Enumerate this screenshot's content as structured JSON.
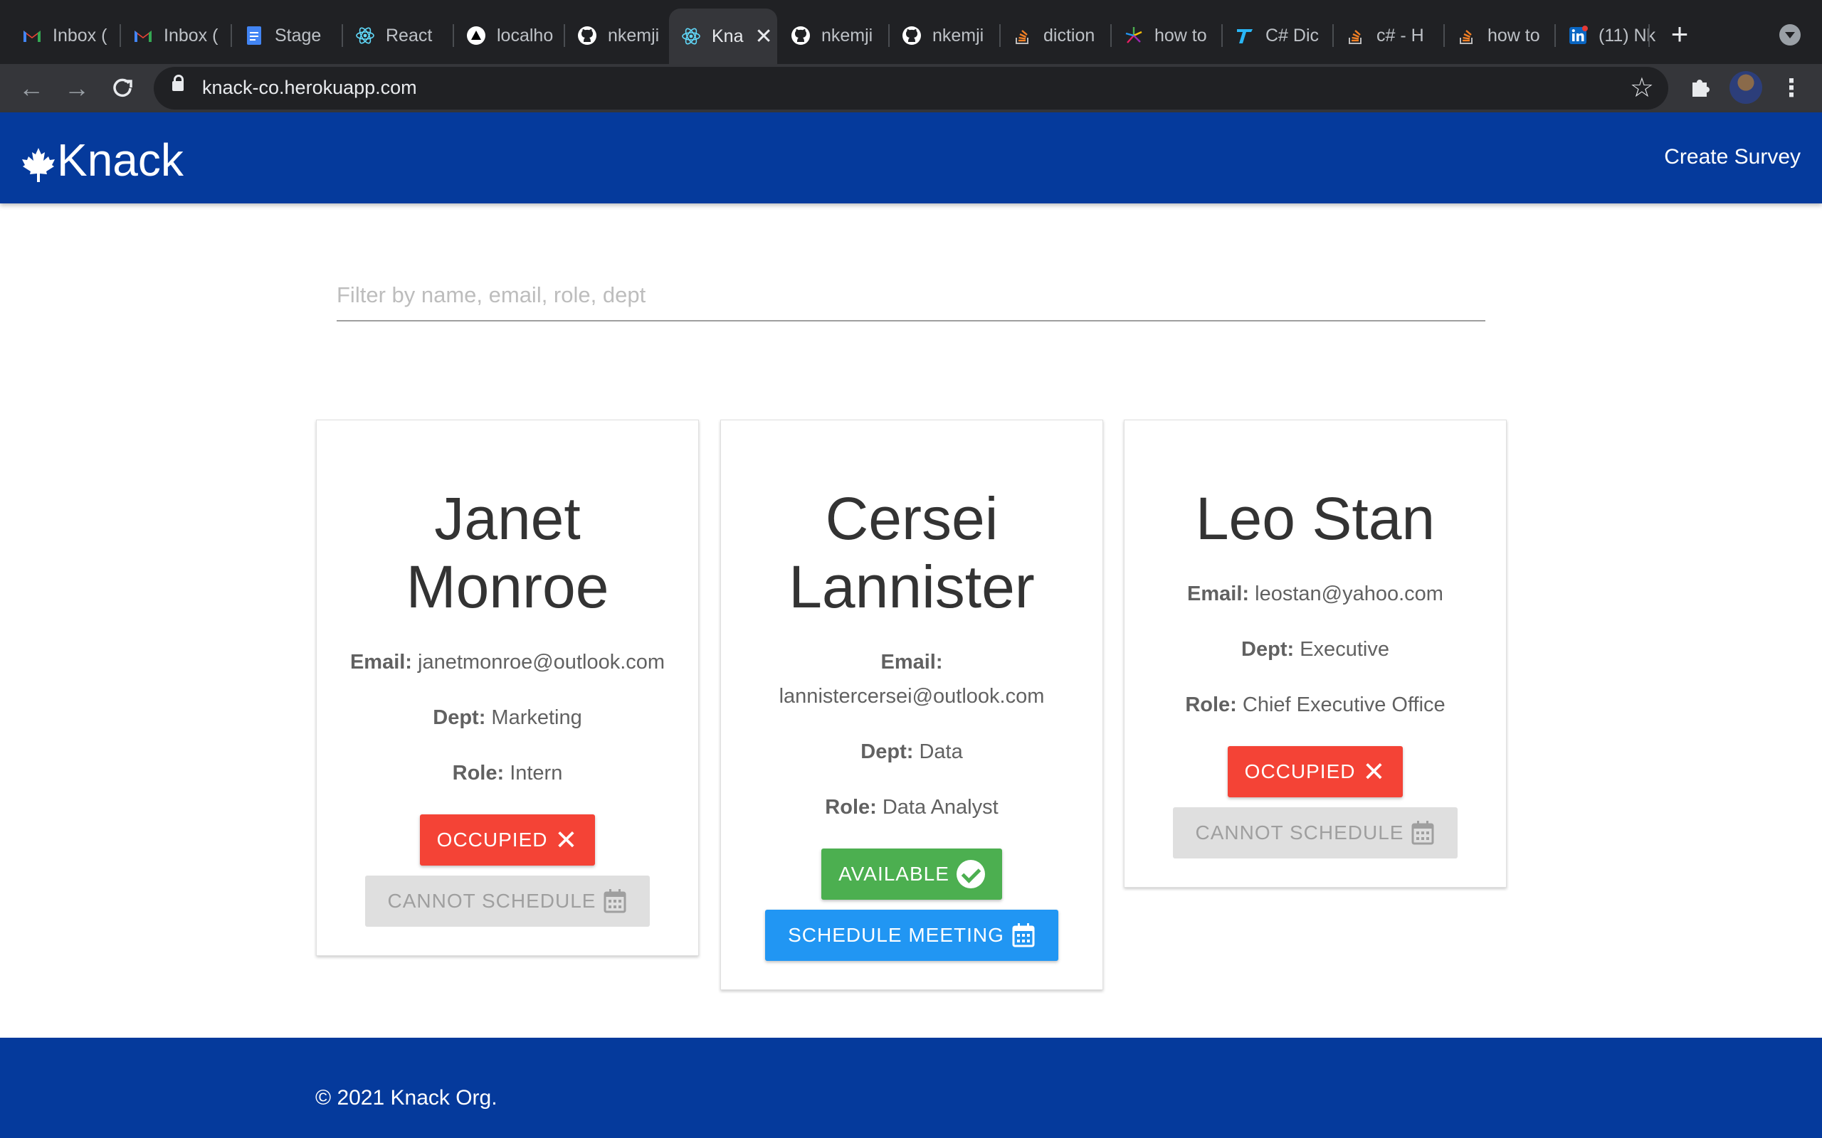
{
  "browser": {
    "tabs": [
      {
        "title": "Inbox (",
        "icon": "gmail-icon"
      },
      {
        "title": "Inbox (",
        "icon": "gmail-icon"
      },
      {
        "title": "Stage",
        "icon": "docs-icon"
      },
      {
        "title": "React",
        "icon": "react-icon"
      },
      {
        "title": "localho",
        "icon": "vercel-icon"
      },
      {
        "title": "nkemji",
        "icon": "github-icon"
      },
      {
        "title": "Kna",
        "icon": "react-icon",
        "active": true
      },
      {
        "title": "nkemji",
        "icon": "github-icon"
      },
      {
        "title": "nkemji",
        "icon": "github-icon"
      },
      {
        "title": "diction",
        "icon": "stackoverflow-icon"
      },
      {
        "title": "how to",
        "icon": "sparkle-icon"
      },
      {
        "title": "C# Dic",
        "icon": "tutorialsteacher-icon"
      },
      {
        "title": "c# - H",
        "icon": "stackoverflow-icon"
      },
      {
        "title": "how to",
        "icon": "stackoverflow-icon"
      },
      {
        "title": "(11) Nk",
        "icon": "linkedin-icon"
      }
    ],
    "url": "knack-co.herokuapp.com"
  },
  "header": {
    "brand": "Knack",
    "create_survey": "Create Survey"
  },
  "filter": {
    "placeholder": "Filter by name, email, role, dept"
  },
  "labels": {
    "email": "Email:",
    "dept": "Dept:",
    "role": "Role:"
  },
  "employees": [
    {
      "name": "Janet Monroe",
      "email": "janetmonroe@outlook.com",
      "dept": "Marketing",
      "role": "Intern",
      "status": "OCCUPIED",
      "action": "CANNOT SCHEDULE"
    },
    {
      "name": "Cersei Lannister",
      "email": "lannistercersei@outlook.com",
      "dept": "Data",
      "role": "Data Analyst",
      "status": "AVAILABLE",
      "action": "SCHEDULE MEETING"
    },
    {
      "name": "Leo Stan",
      "email": "leostan@yahoo.com",
      "dept": "Executive",
      "role": "Chief Executive Office",
      "status": "OCCUPIED",
      "action": "CANNOT SCHEDULE"
    }
  ],
  "footer": {
    "copyright": "© 2021 Knack Org."
  },
  "colors": {
    "brand_blue": "#053a9c",
    "occupied": "#f44336",
    "available": "#4caf50",
    "schedule": "#2196f3",
    "disabled": "#dfdfdf"
  }
}
